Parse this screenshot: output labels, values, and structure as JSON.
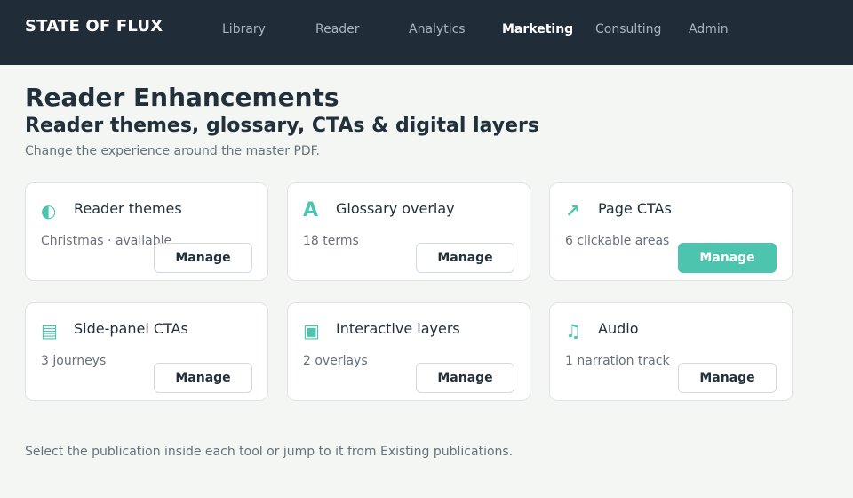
{
  "brand": "STATE OF FLUX",
  "nav": [
    {
      "label": "Library"
    },
    {
      "label": "Reader"
    },
    {
      "label": "Analytics"
    },
    {
      "label": "Marketing"
    },
    {
      "label": "Consulting"
    },
    {
      "label": "Admin"
    }
  ],
  "active_nav": "Marketing",
  "page": {
    "title": "Reader Enhancements",
    "subtitle": "Reader themes, glossary, CTAs & digital layers",
    "description": "Change the experience around the master PDF."
  },
  "cards": [
    {
      "icon": "half-circle-icon",
      "glyph": "◐",
      "title": "Reader themes",
      "meta": "Christmas · available",
      "button": "Manage"
    },
    {
      "icon": "letter-a-icon",
      "glyph": "A",
      "title": "Glossary overlay",
      "meta": "18 terms",
      "button": "Manage"
    },
    {
      "icon": "arrow-up-right-icon",
      "glyph": "↗",
      "title": "Page CTAs",
      "meta": "6 clickable areas",
      "button": "Manage",
      "highlighted": true
    },
    {
      "icon": "side-panel-icon",
      "glyph": "▤",
      "title": "Side-panel CTAs",
      "meta": "3 journeys",
      "button": "Manage"
    },
    {
      "icon": "layers-square-icon",
      "glyph": "▣",
      "title": "Interactive layers",
      "meta": "2 overlays",
      "button": "Manage"
    },
    {
      "icon": "music-note-icon",
      "glyph": "♫",
      "title": "Audio",
      "meta": "1 narration track",
      "button": "Manage"
    }
  ],
  "footer_note": "Select the publication inside each tool or jump to it from Existing publications.",
  "colors": {
    "topbar": "#202c38",
    "accent": "#4cc4ae",
    "background": "#f4f6f4"
  }
}
